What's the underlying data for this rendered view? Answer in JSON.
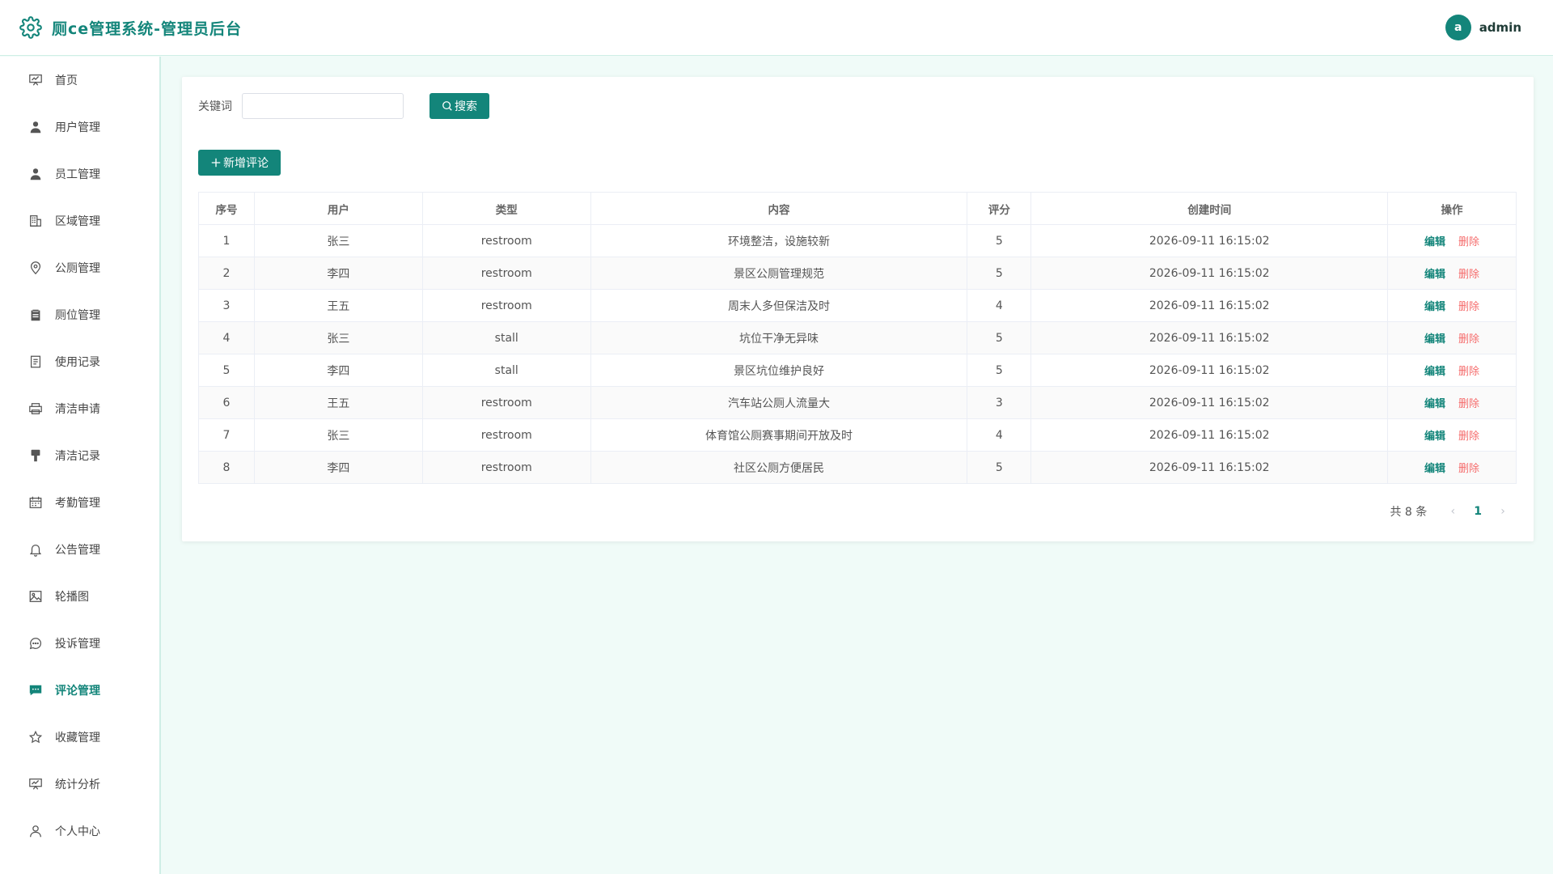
{
  "app": {
    "title": "厕ce管理系统-管理员后台"
  },
  "user": {
    "avatar_letter": "a",
    "name": "admin"
  },
  "sidebar": {
    "items": [
      {
        "label": "首页",
        "icon": "presentation-icon"
      },
      {
        "label": "用户管理",
        "icon": "user-icon"
      },
      {
        "label": "员工管理",
        "icon": "user-icon"
      },
      {
        "label": "区域管理",
        "icon": "building-icon"
      },
      {
        "label": "公厕管理",
        "icon": "location-icon"
      },
      {
        "label": "厕位管理",
        "icon": "clipboard-icon"
      },
      {
        "label": "使用记录",
        "icon": "document-icon"
      },
      {
        "label": "清洁申请",
        "icon": "printer-icon"
      },
      {
        "label": "清洁记录",
        "icon": "brush-icon"
      },
      {
        "label": "考勤管理",
        "icon": "calendar-icon"
      },
      {
        "label": "公告管理",
        "icon": "bell-icon"
      },
      {
        "label": "轮播图",
        "icon": "picture-icon"
      },
      {
        "label": "投诉管理",
        "icon": "chat-icon"
      },
      {
        "label": "评论管理",
        "icon": "comment-icon",
        "active": true
      },
      {
        "label": "收藏管理",
        "icon": "star-icon"
      },
      {
        "label": "统计分析",
        "icon": "presentation-icon"
      },
      {
        "label": "个人中心",
        "icon": "user-outline-icon"
      }
    ]
  },
  "search": {
    "keyword_label": "关键词",
    "placeholder": "",
    "button_label": "搜索"
  },
  "toolbar": {
    "add_label": "新增评论"
  },
  "table": {
    "headers": [
      "序号",
      "用户",
      "类型",
      "内容",
      "评分",
      "创建时间",
      "操作"
    ],
    "rows": [
      {
        "no": "1",
        "user": "张三",
        "type": "restroom",
        "content": "环境整洁，设施较新",
        "score": "5",
        "created": "2026-09-11 16:15:02"
      },
      {
        "no": "2",
        "user": "李四",
        "type": "restroom",
        "content": "景区公厕管理规范",
        "score": "5",
        "created": "2026-09-11 16:15:02"
      },
      {
        "no": "3",
        "user": "王五",
        "type": "restroom",
        "content": "周末人多但保洁及时",
        "score": "4",
        "created": "2026-09-11 16:15:02"
      },
      {
        "no": "4",
        "user": "张三",
        "type": "stall",
        "content": "坑位干净无异味",
        "score": "5",
        "created": "2026-09-11 16:15:02"
      },
      {
        "no": "5",
        "user": "李四",
        "type": "stall",
        "content": "景区坑位维护良好",
        "score": "5",
        "created": "2026-09-11 16:15:02"
      },
      {
        "no": "6",
        "user": "王五",
        "type": "restroom",
        "content": "汽车站公厕人流量大",
        "score": "3",
        "created": "2026-09-11 16:15:02"
      },
      {
        "no": "7",
        "user": "张三",
        "type": "restroom",
        "content": "体育馆公厕赛事期间开放及时",
        "score": "4",
        "created": "2026-09-11 16:15:02"
      },
      {
        "no": "8",
        "user": "李四",
        "type": "restroom",
        "content": "社区公厕方便居民",
        "score": "5",
        "created": "2026-09-11 16:15:02"
      }
    ],
    "edit_label": "编辑",
    "delete_label": "删除"
  },
  "pagination": {
    "total_text": "共 8 条",
    "current_page": "1"
  },
  "colors": {
    "accent": "#13857a",
    "danger": "#f56c6c",
    "background": "#f0fbf8"
  }
}
